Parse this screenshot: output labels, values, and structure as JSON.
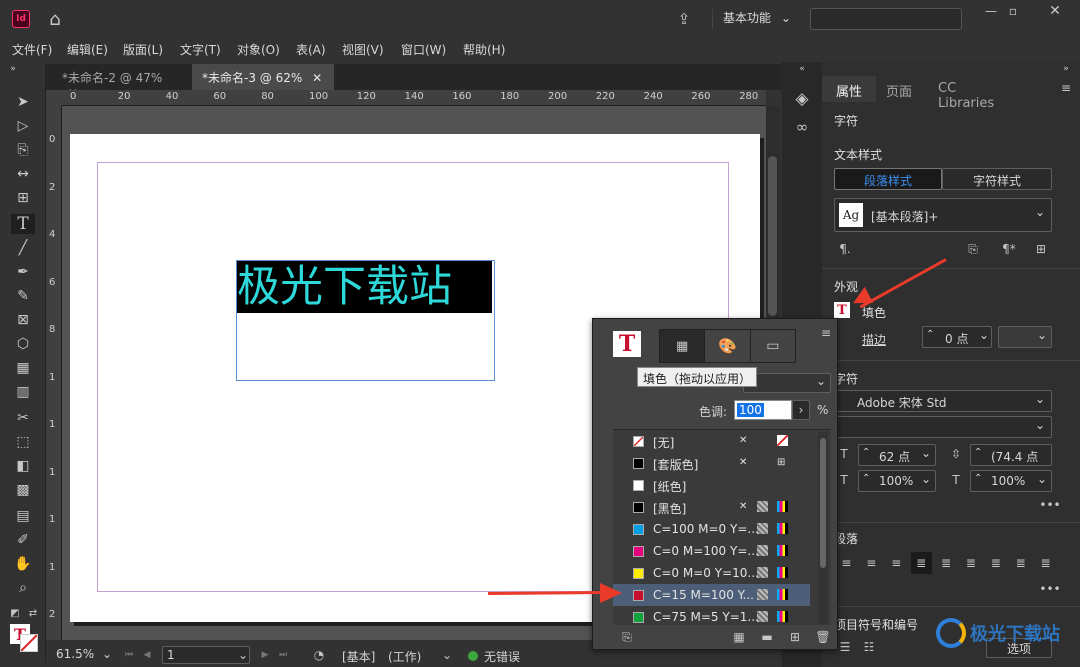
{
  "app": {
    "logo": "Id",
    "workspace": "基本功能",
    "search_placeholder": ""
  },
  "menu": [
    "文件(F)",
    "编辑(E)",
    "版面(L)",
    "文字(T)",
    "对象(O)",
    "表(A)",
    "视图(V)",
    "窗口(W)",
    "帮助(H)"
  ],
  "doc_tabs": [
    {
      "label": "*未命名-2 @ 47%",
      "active": false
    },
    {
      "label": "*未命名-3 @ 62%",
      "active": true
    }
  ],
  "ruler_h": [
    "0",
    "20",
    "40",
    "60",
    "80",
    "100",
    "120",
    "140",
    "160",
    "180",
    "200",
    "220",
    "240",
    "260",
    "280"
  ],
  "ruler_v": [
    "0",
    "2",
    "4",
    "6",
    "8",
    "1",
    "1",
    "1",
    "1",
    "1",
    "2"
  ],
  "document_text": "极光下载站",
  "status": {
    "zoom": "61.5%",
    "page": "1",
    "style": "[基本]",
    "mode": "(工作)",
    "errors": "无错误"
  },
  "props": {
    "tabs": [
      "属性",
      "页面",
      "CC Libraries"
    ],
    "section_char": "字符",
    "text_style": "文本样式",
    "para_style_tab": "段落样式",
    "char_style_tab": "字符样式",
    "para_style_value": "[基本段落]+",
    "style_icon": "Ag",
    "appearance": "外观",
    "fill_label": "填色",
    "stroke_label": "描边",
    "stroke_value": "0 点",
    "font": "Adobe 宋体 Std",
    "font_size": "62 点",
    "leading": "(74.4 点",
    "h_scale": "100%",
    "v_scale": "100%",
    "section_para": "段落",
    "section_bullets": "项目符号和编号",
    "options_button": "选项",
    "section_char_label": "字符"
  },
  "swatches": {
    "tint_label": "色调:",
    "tint_value": "100",
    "tint_unit": "%",
    "tooltip": "填色（拖动以应用）",
    "rows": [
      {
        "name": "[无]",
        "color": "none"
      },
      {
        "name": "[套版色]",
        "color": "#000000"
      },
      {
        "name": "[纸色]",
        "color": "#ffffff"
      },
      {
        "name": "[黑色]",
        "color": "#000000"
      },
      {
        "name": "C=100 M=0 Y=...",
        "color": "#009fe3"
      },
      {
        "name": "C=0 M=100 Y=...",
        "color": "#e6007e"
      },
      {
        "name": "C=0 M=0 Y=10...",
        "color": "#ffed00"
      },
      {
        "name": "C=15 M=100 Y...",
        "color": "#c8102e",
        "selected": true
      },
      {
        "name": "C=75 M=5 Y=1...",
        "color": "#14a23c"
      }
    ]
  },
  "watermark": {
    "text": "极光下载站"
  },
  "colors": {
    "accent": "#1473e6",
    "arrow": "#ea3b2a",
    "text_cyan": "#2ed8d8"
  }
}
